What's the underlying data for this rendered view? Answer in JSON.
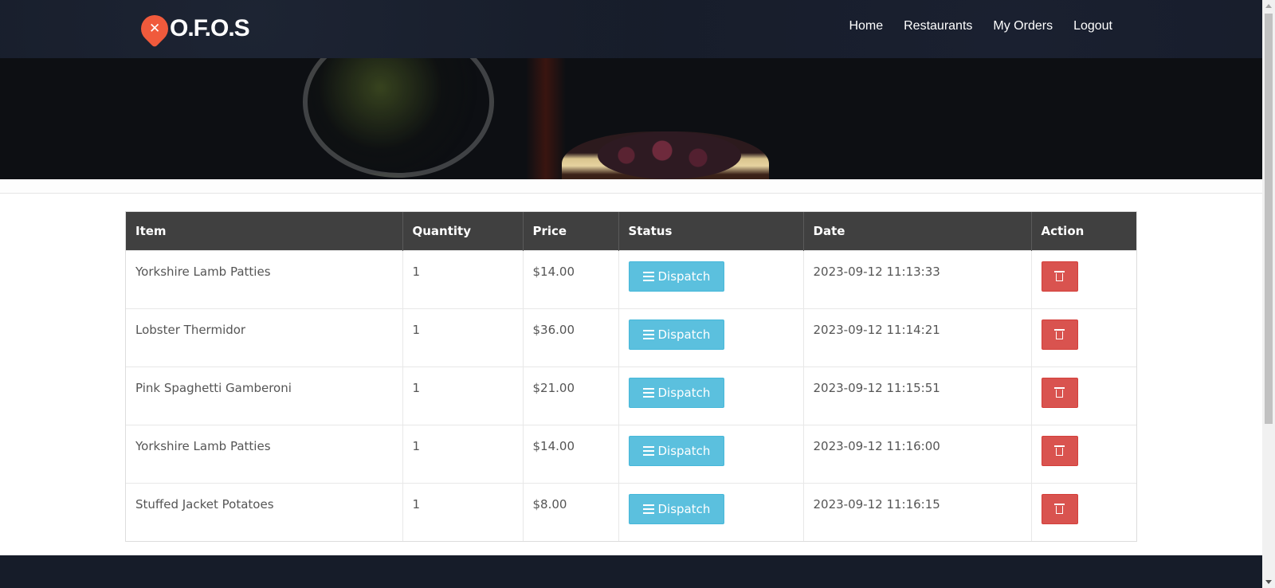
{
  "header": {
    "logo_text": "O.F.O.S",
    "logo_icon": "utensils-pin-icon",
    "nav": [
      {
        "label": "Home"
      },
      {
        "label": "Restaurants"
      },
      {
        "label": "My Orders"
      },
      {
        "label": "Logout"
      }
    ]
  },
  "orders_table": {
    "columns": [
      "Item",
      "Quantity",
      "Price",
      "Status",
      "Date",
      "Action"
    ],
    "rows": [
      {
        "item": "Yorkshire Lamb Patties",
        "quantity": "1",
        "price": "$14.00",
        "status": "Dispatch",
        "date": "2023-09-12 11:13:33"
      },
      {
        "item": "Lobster Thermidor",
        "quantity": "1",
        "price": "$36.00",
        "status": "Dispatch",
        "date": "2023-09-12 11:14:21"
      },
      {
        "item": "Pink Spaghetti Gamberoni",
        "quantity": "1",
        "price": "$21.00",
        "status": "Dispatch",
        "date": "2023-09-12 11:15:51"
      },
      {
        "item": "Yorkshire Lamb Patties",
        "quantity": "1",
        "price": "$14.00",
        "status": "Dispatch",
        "date": "2023-09-12 11:16:00"
      },
      {
        "item": "Stuffed Jacket Potatoes",
        "quantity": "1",
        "price": "$8.00",
        "status": "Dispatch",
        "date": "2023-09-12 11:16:15"
      }
    ]
  },
  "icons": {
    "status": "menu-icon",
    "action": "trash-icon"
  },
  "colors": {
    "header_bg": "#161c29",
    "table_header": "#404040",
    "dispatch": "#5bc0de",
    "delete": "#d9534f",
    "brand": "#f05a3c"
  }
}
